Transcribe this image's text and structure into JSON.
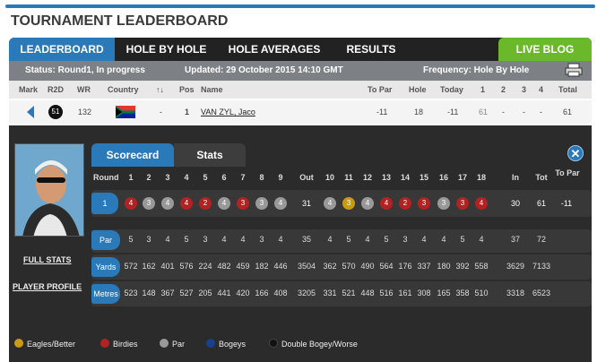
{
  "title": "TOURNAMENT LEADERBOARD",
  "tabs": {
    "leaderboard": "LEADERBOARD",
    "hole_by_hole": "HOLE BY HOLE",
    "hole_averages": "HOLE AVERAGES",
    "results": "RESULTS",
    "live_blog": "LIVE BLOG"
  },
  "status": {
    "status": "Status: Round1, In progress",
    "updated": "Updated: 29 October 2015 14:10 GMT",
    "frequency": "Frequency: Hole By Hole"
  },
  "columns": {
    "mark": "Mark",
    "r2d": "R2D",
    "wr": "WR",
    "country": "Country",
    "arrows": "↑↓",
    "pos": "Pos",
    "name": "Name",
    "to_par": "To Par",
    "hole": "Hole",
    "today": "Today",
    "r1": "1",
    "r2": "2",
    "r3": "3",
    "r4": "4",
    "total": "Total"
  },
  "player": {
    "r2d": "51",
    "wr": "132",
    "move": "-",
    "pos": "1",
    "name": "VAN ZYL, Jaco",
    "to_par": "-11",
    "hole": "18",
    "today": "-11",
    "r1": "61",
    "r2": "-",
    "r3": "-",
    "r4": "-",
    "total": "61"
  },
  "detail": {
    "scorecard_tab": "Scorecard",
    "stats_tab": "Stats",
    "close": "✕",
    "full_stats": "FULL STATS",
    "player_profile": "PLAYER PROFILE"
  },
  "scorecard": {
    "headers": [
      "Round",
      "1",
      "2",
      "3",
      "4",
      "5",
      "6",
      "7",
      "8",
      "9",
      "Out",
      "10",
      "11",
      "12",
      "13",
      "14",
      "15",
      "16",
      "17",
      "18",
      "In",
      "Tot",
      "To Par"
    ],
    "round_label": "1",
    "scores": [
      "4",
      "3",
      "4",
      "4",
      "2",
      "4",
      "3",
      "3",
      "4",
      "31",
      "4",
      "3",
      "4",
      "4",
      "2",
      "3",
      "3",
      "3",
      "4",
      "30",
      "61",
      "-11"
    ],
    "score_types": [
      "birdie",
      "par",
      "par",
      "birdie",
      "birdie",
      "par",
      "birdie",
      "par",
      "par",
      "",
      "par",
      "eagle",
      "par",
      "birdie",
      "birdie",
      "birdie",
      "par",
      "birdie",
      "birdie",
      "",
      "",
      ""
    ],
    "par_label": "Par",
    "par": [
      "5",
      "3",
      "4",
      "5",
      "3",
      "4",
      "4",
      "3",
      "4",
      "35",
      "4",
      "5",
      "4",
      "5",
      "3",
      "4",
      "4",
      "5",
      "4",
      "37",
      "72"
    ],
    "yards_label": "Yards",
    "yards": [
      "572",
      "162",
      "401",
      "576",
      "224",
      "482",
      "459",
      "182",
      "446",
      "3504",
      "362",
      "570",
      "490",
      "564",
      "176",
      "337",
      "180",
      "392",
      "558",
      "3629",
      "7133"
    ],
    "metres_label": "Metres",
    "metres": [
      "523",
      "148",
      "367",
      "527",
      "205",
      "441",
      "420",
      "166",
      "408",
      "3205",
      "331",
      "521",
      "448",
      "516",
      "161",
      "308",
      "165",
      "358",
      "510",
      "3318",
      "6523"
    ]
  },
  "legend": {
    "eagles": "Eagles/Better",
    "birdies": "Birdies",
    "par": "Par",
    "bogeys": "Bogeys",
    "double": "Double Bogey/Worse"
  },
  "colors": {
    "accent": "#2a79b9",
    "live": "#6cb82b",
    "birdie": "#b22222",
    "par": "#999999",
    "eagle": "#c99a14",
    "bogey": "#1b3f8c",
    "double": "#111111"
  }
}
